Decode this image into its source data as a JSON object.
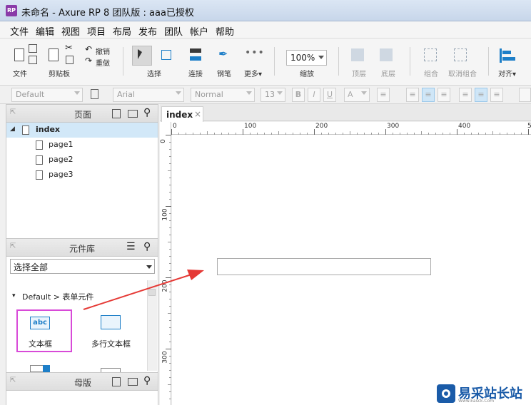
{
  "window": {
    "title": "未命名 - Axure RP 8 团队版 : aaa已授权",
    "app_icon": "RP"
  },
  "menu": [
    "文件",
    "编辑",
    "视图",
    "项目",
    "布局",
    "发布",
    "团队",
    "帐户",
    "帮助"
  ],
  "toolbar": {
    "file": "文件",
    "clipboard": "剪贴板",
    "undo": "撤销",
    "redo": "重做",
    "select": "选择",
    "connect": "连接",
    "pen": "钢笔",
    "more": "更多▾",
    "zoom_value": "100%",
    "zoom": "缩放",
    "top": "顶层",
    "bottom": "底层",
    "group": "组合",
    "ungroup": "取消组合",
    "align": "对齐▾"
  },
  "format": {
    "style": "Default",
    "font": "Arial",
    "weight": "Normal",
    "size": "13",
    "bold": "B",
    "italic": "I",
    "underline": "U",
    "color": "A"
  },
  "pages_panel": {
    "title": "页面",
    "pages": [
      "index",
      "page1",
      "page2",
      "page3"
    ]
  },
  "library_panel": {
    "title": "元件库",
    "select_value": "选择全部",
    "group": "Default > 表单元件",
    "items": [
      "文本框",
      "多行文本框"
    ],
    "textbox_icon_text": "abc"
  },
  "masters_panel": {
    "title": "母版"
  },
  "canvas": {
    "tab": "index",
    "tab_close": "×",
    "hruler": [
      "0",
      "100",
      "200",
      "300",
      "400",
      "5"
    ],
    "vruler": [
      "0",
      "100",
      "200",
      "300"
    ]
  },
  "watermark": {
    "text": "易采站长站",
    "sub": "Www.Easck.Com"
  }
}
